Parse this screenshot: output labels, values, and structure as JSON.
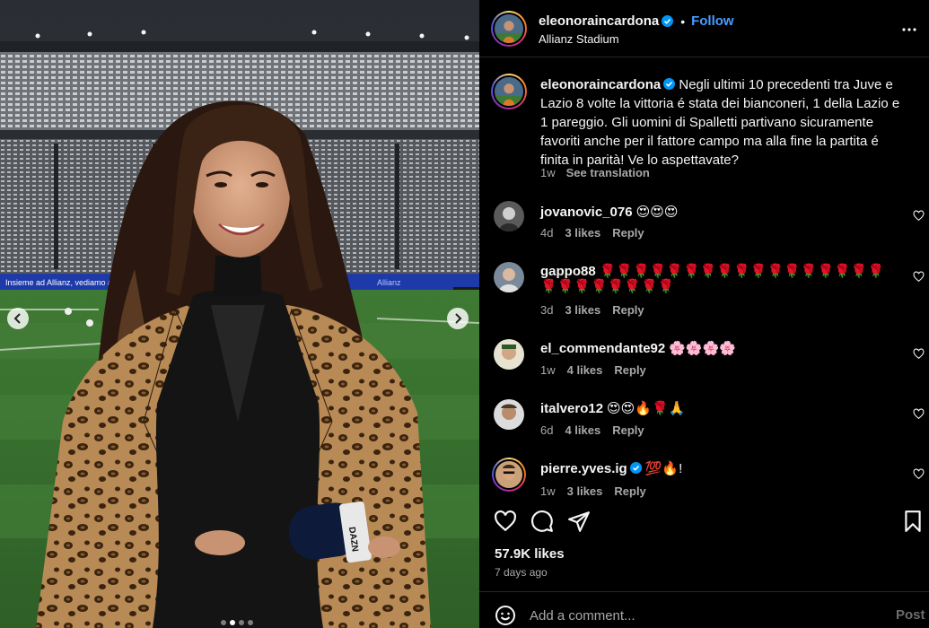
{
  "post": {
    "author": "eleonoraincardona",
    "follow_label": "Follow",
    "separator": "•",
    "location": "Allianz Stadium",
    "carousel": {
      "slide_count": 4,
      "active_index": 1
    }
  },
  "caption": {
    "username": "eleonoraincardona",
    "text": "Negli ultimi 10 precedenti tra Juve e Lazio 8 volte la vittoria é stata dei bianconeri, 1 della Lazio e 1 pareggio. Gli uomini di Spalletti partivano sicuramente favoriti anche per il fattore campo ma alla fine la partita é finita in parità! Ve lo aspettavate?",
    "time": "1w",
    "see_translation": "See translation"
  },
  "comments": [
    {
      "username": "jovanovic_076",
      "verified": false,
      "text": "😍😍😍",
      "time": "4d",
      "likes": "3 likes",
      "reply": "Reply"
    },
    {
      "username": "gappo88",
      "verified": false,
      "text": "🌹🌹🌹🌹🌹🌹🌹🌹🌹🌹🌹🌹🌹🌹🌹🌹🌹🌹🌹🌹🌹🌹🌹🌹🌹",
      "time": "3d",
      "likes": "3 likes",
      "reply": "Reply"
    },
    {
      "username": "el_commendante92",
      "verified": false,
      "text": "🌸🌸🌸🌸",
      "time": "1w",
      "likes": "4 likes",
      "reply": "Reply"
    },
    {
      "username": "italvero12",
      "verified": false,
      "text": "😍😍🔥🌹🙏",
      "time": "6d",
      "likes": "4 likes",
      "reply": "Reply"
    },
    {
      "username": "pierre.yves.ig",
      "verified": true,
      "text": "💯🔥!",
      "time": "1w",
      "likes": "3 likes",
      "reply": "Reply"
    }
  ],
  "stats": {
    "likes": "57.9K likes",
    "time_ago": "7 days ago"
  },
  "composer": {
    "placeholder": "Add a comment...",
    "post_label": "Post"
  },
  "colors": {
    "link_blue": "#4a9dff",
    "verified_blue": "#0095f6",
    "muted_text": "#a8a8a8",
    "divider": "#262626"
  },
  "icons": {
    "media": [
      "chevron-left-icon",
      "chevron-right-icon"
    ],
    "actions": [
      "heart-icon",
      "comment-icon",
      "share-icon",
      "bookmark-icon"
    ],
    "other": [
      "more-options-icon",
      "verified-badge-icon",
      "emoji-icon"
    ]
  }
}
